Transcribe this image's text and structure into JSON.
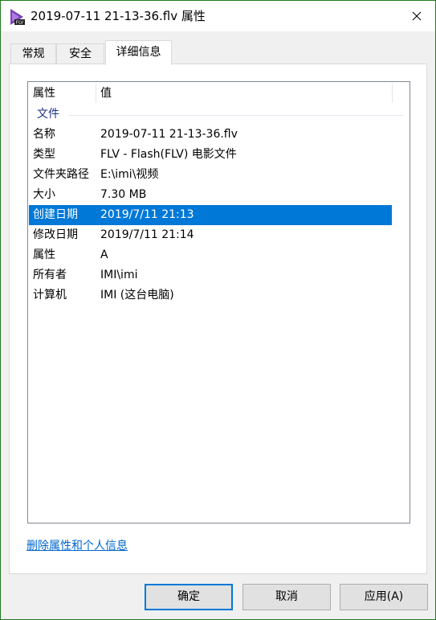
{
  "window": {
    "title": "2019-07-11 21-13-36.flv 属性",
    "icon_label": "FLV",
    "close_icon": "close-icon"
  },
  "tabs": [
    {
      "label": "常规"
    },
    {
      "label": "安全"
    },
    {
      "label": "详细信息",
      "active": true
    }
  ],
  "list": {
    "col_property": "属性",
    "col_value": "值",
    "group": "文件",
    "rows": [
      {
        "key": "名称",
        "value": "2019-07-11 21-13-36.flv"
      },
      {
        "key": "类型",
        "value": "FLV - Flash(FLV) 电影文件"
      },
      {
        "key": "文件夹路径",
        "value": "E:\\imi\\视频"
      },
      {
        "key": "大小",
        "value": "7.30 MB"
      },
      {
        "key": "创建日期",
        "value": "2019/7/11 21:13",
        "selected": true
      },
      {
        "key": "修改日期",
        "value": "2019/7/11 21:14"
      },
      {
        "key": "属性",
        "value": "A"
      },
      {
        "key": "所有者",
        "value": "IMI\\imi"
      },
      {
        "key": "计算机",
        "value": "IMI (这台电脑)"
      }
    ]
  },
  "link_remove": "删除属性和个人信息",
  "buttons": {
    "ok": "确定",
    "cancel": "取消",
    "apply": "应用(A)"
  },
  "colors": {
    "selection": "#0078d7",
    "link": "#0066cc",
    "frame": "#1f7a1f"
  }
}
